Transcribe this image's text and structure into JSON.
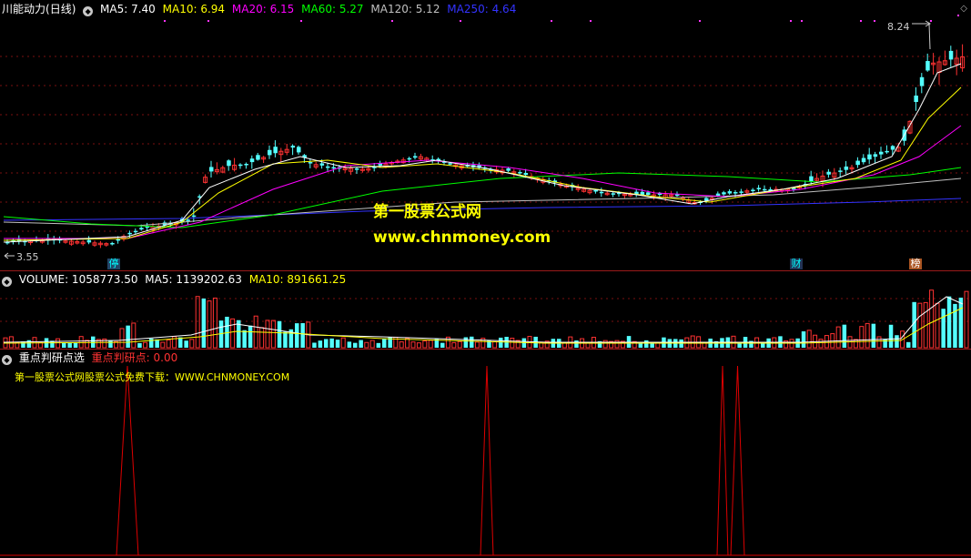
{
  "main": {
    "stock_name": "川能动力",
    "period": "(日线)",
    "ma": [
      {
        "label": "MA5: 7.40",
        "color": "#ffffff"
      },
      {
        "label": "MA10: 6.94",
        "color": "#ffff00"
      },
      {
        "label": "MA20: 6.15",
        "color": "#ff00ff"
      },
      {
        "label": "MA60: 5.27",
        "color": "#00ff00"
      },
      {
        "label": "MA120: 5.12",
        "color": "#c0c0c0"
      },
      {
        "label": "MA250: 4.64",
        "color": "#2222ff"
      }
    ],
    "high_label": "8.24",
    "low_label": "3.55",
    "tags": [
      {
        "text": "停",
        "color": "#00ffff",
        "bg": "#224466"
      },
      {
        "text": "财",
        "color": "#00ffff",
        "bg": "#223355"
      },
      {
        "text": "榜",
        "color": "#ffffff",
        "bg": "#aa5522"
      }
    ],
    "watermark_cn": "第一股票公式网",
    "watermark_url": "www.chnmoney.com"
  },
  "volume": {
    "title": "VOLUME: 1058773.50",
    "ma5": "MA5: 1139202.63",
    "ma10": "MA10: 891661.25"
  },
  "indicator": {
    "title": "重点判研点选",
    "value_label": "重点判研点: 0.00",
    "note": "第一股票公式网股票公式免费下载：WWW.CHNMONEY.COM"
  },
  "colors": {
    "up": "#ff3232",
    "down": "#54ffff",
    "separator": "#9a1a1a",
    "indicator_line": "#dd0000"
  },
  "chart_data": {
    "type": "candlestick",
    "series": [
      {
        "name": "MA5",
        "values": [
          7.4
        ]
      },
      {
        "name": "MA10",
        "values": [
          6.94
        ]
      },
      {
        "name": "MA20",
        "values": [
          6.15
        ]
      },
      {
        "name": "MA60",
        "values": [
          5.27
        ]
      },
      {
        "name": "MA120",
        "values": [
          5.12
        ]
      },
      {
        "name": "MA250",
        "values": [
          4.64
        ]
      }
    ],
    "price_high": 8.24,
    "price_low": 3.55,
    "volume_last": 1058773.5,
    "volume_ma5": 1139202.63,
    "volume_ma10": 891661.25,
    "indicator_last": 0.0
  }
}
